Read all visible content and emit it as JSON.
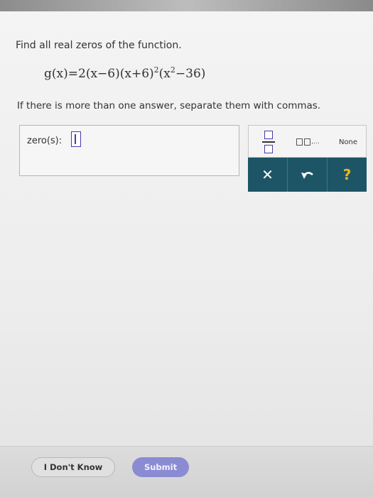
{
  "question": {
    "prompt": "Find all real zeros of the function.",
    "formula": {
      "lhs": "g(x)",
      "equals": "=",
      "coefficient": "2",
      "factor1": "(x−6)",
      "factor2": "(x+6)",
      "factor2_exponent": "2",
      "factor3_open": "(x",
      "factor3_exponent": "2",
      "factor3_close": "−36)"
    },
    "instruction": "If there is more than one answer, separate them with commas."
  },
  "answer": {
    "label": "zero(s):",
    "value": ""
  },
  "keypad": {
    "list_key_label": ",  ,...",
    "none_key_label": "None",
    "clear_symbol": "✕",
    "undo_symbol": "↶",
    "help_symbol": "?"
  },
  "footer": {
    "dont_know_label": "I Don't Know",
    "submit_label": "Submit"
  },
  "colors": {
    "accent": "#4a3aa8",
    "keypad_bar": "#1d5566",
    "help": "#f0b41c",
    "submit_bg": "#8b8bd4"
  }
}
